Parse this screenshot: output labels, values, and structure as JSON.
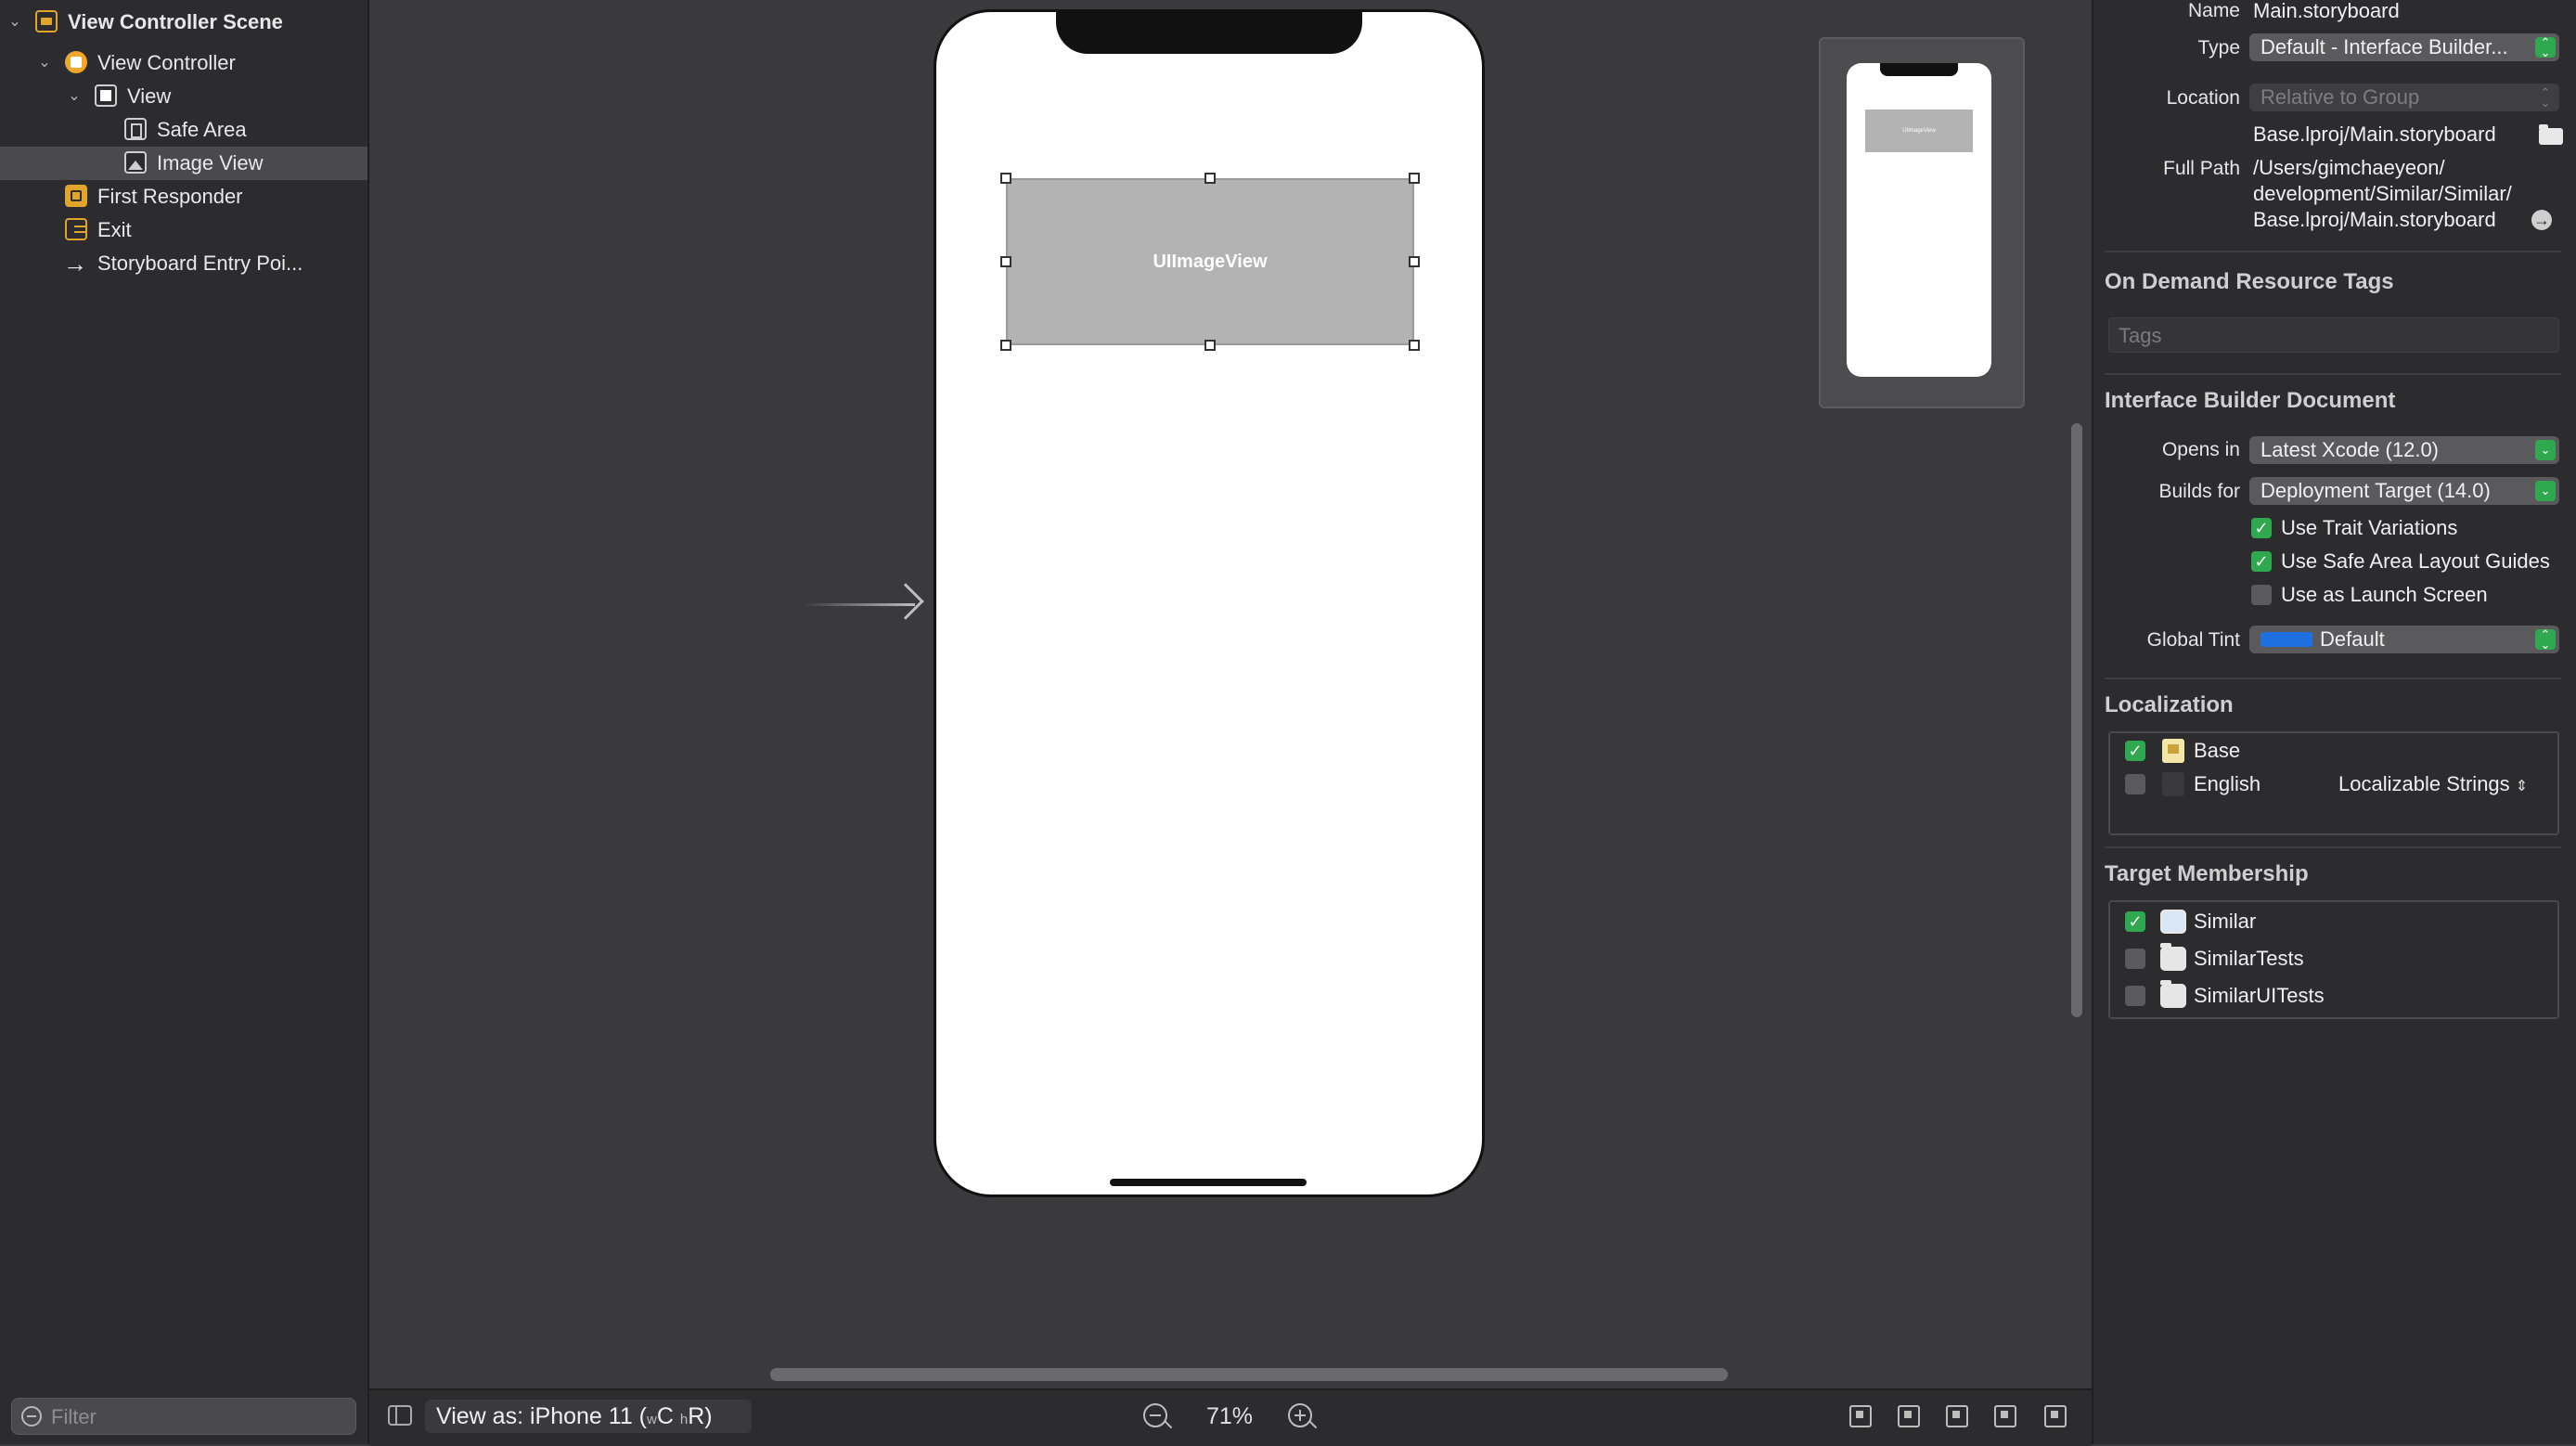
{
  "navigator": {
    "items": [
      {
        "label": "View Controller Scene"
      },
      {
        "label": "View Controller"
      },
      {
        "label": "View"
      },
      {
        "label": "Safe Area"
      },
      {
        "label": "Image View"
      },
      {
        "label": "First Responder"
      },
      {
        "label": "Exit"
      },
      {
        "label": "Storyboard Entry Poi..."
      }
    ],
    "filter_placeholder": "Filter"
  },
  "canvas": {
    "image_view_label": "UIImageView"
  },
  "bottombar": {
    "view_as_prefix": "View as: iPhone 11 (",
    "w_small": "w",
    "w_big": "C ",
    "h_small": "h",
    "h_big": "R)",
    "zoom_level": "71%"
  },
  "inspector": {
    "name_label": "Name",
    "name_value": "Main.storyboard",
    "type_label": "Type",
    "type_value": "Default - Interface Builder...",
    "location_label": "Location",
    "location_value": "Relative to Group",
    "file_name": "Base.lproj/Main.storyboard",
    "full_path_label": "Full Path",
    "full_path_line1": "/Users/gimchaeyeon/",
    "full_path_line2": "development/Similar/Similar/",
    "full_path_line3": "Base.lproj/Main.storyboard",
    "on_demand_title": "On Demand Resource Tags",
    "tags_placeholder": "Tags",
    "ib_document_title": "Interface Builder Document",
    "opens_in_label": "Opens in",
    "opens_in_value": "Latest Xcode (12.0)",
    "builds_for_label": "Builds for",
    "builds_for_value": "Deployment Target (14.0)",
    "use_trait_variations": "Use Trait Variations",
    "use_safe_area": "Use Safe Area Layout Guides",
    "use_as_launch": "Use as Launch Screen",
    "global_tint_label": "Global Tint",
    "global_tint_value": "Default",
    "localization_title": "Localization",
    "loc_base": "Base",
    "loc_english": "English",
    "loc_english_option": "Localizable Strings",
    "target_membership_title": "Target Membership",
    "target_similar": "Similar",
    "target_tests": "SimilarTests",
    "target_uitests": "SimilarUITests"
  },
  "colors": {
    "accent_green": "#2fa84f",
    "tint_blue": "#1e6fe0",
    "scene_orange": "#e0a52a"
  },
  "icons": {
    "scene": "scene-icon",
    "view_controller": "view-controller-icon",
    "view": "view-icon",
    "safe_area": "safe-area-icon",
    "image_view": "image-view-icon",
    "first_responder": "first-responder-icon",
    "exit": "exit-icon",
    "entry_point": "arrow-right-icon"
  }
}
